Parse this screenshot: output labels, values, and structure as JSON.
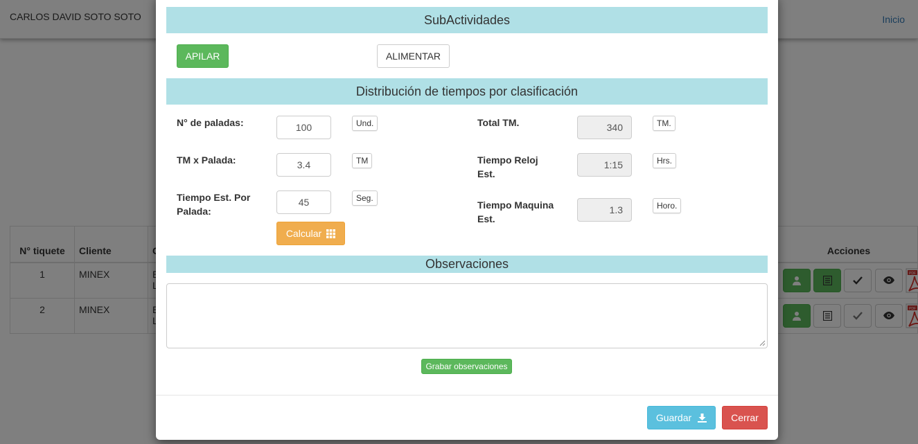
{
  "navbar": {
    "user": "CARLOS DAVID SOTO SOTO",
    "home_link": "Inicio"
  },
  "table": {
    "headers": [
      "N° tiquete",
      "Cliente",
      "C",
      "Acciones"
    ],
    "rows": [
      {
        "num": "1",
        "client": "MINEX",
        "col3_line1": "E",
        "col3_line2": "L"
      },
      {
        "num": "2",
        "client": "MINEX",
        "col3_line1": "E",
        "col3_line2": "L"
      }
    ]
  },
  "modal": {
    "subactividades_title": "SubActividades",
    "apilar_label": "APILAR",
    "alimentar_label": "ALIMENTAR",
    "distribucion_title": "Distribución de tiempos por clasificación",
    "left": {
      "paladas": {
        "label": "N° de paladas:",
        "value": "100",
        "unit": "Und."
      },
      "tm_palada": {
        "label": "TM x Palada:",
        "value": "3.4",
        "unit": "TM"
      },
      "tiempo_palada": {
        "label_line1": "Tiempo Est. Por",
        "label_line2": "Palada:",
        "value": "45",
        "unit": "Seg."
      }
    },
    "right": {
      "total_tm": {
        "label": "Total TM.",
        "value": "340",
        "unit": "TM."
      },
      "tiempo_reloj": {
        "label_line1": "Tiempo Reloj",
        "label_line2": "Est.",
        "value": "1:15",
        "unit": "Hrs."
      },
      "tiempo_maquina": {
        "label_line1": "Tiempo Maquina",
        "label_line2": "Est.",
        "value": "1.3",
        "unit": "Horo."
      }
    },
    "calcular_label": "Calcular",
    "observaciones_title": "Observaciones",
    "observaciones_value": "",
    "grabar_label": "Grabar observaciones",
    "guardar_label": "Guardar",
    "cerrar_label": "Cerrar"
  },
  "icons": {
    "calcular": "grid-icon",
    "guardar": "download-icon",
    "actions": [
      "user-icon",
      "list-icon",
      "check-icon",
      "eye-icon",
      "pdf-icon"
    ]
  },
  "colors": {
    "section_header": "#b0e0e6",
    "success": "#5cb85c",
    "warning": "#f0ad4e",
    "info": "#5bc0de",
    "danger": "#d9534f"
  }
}
